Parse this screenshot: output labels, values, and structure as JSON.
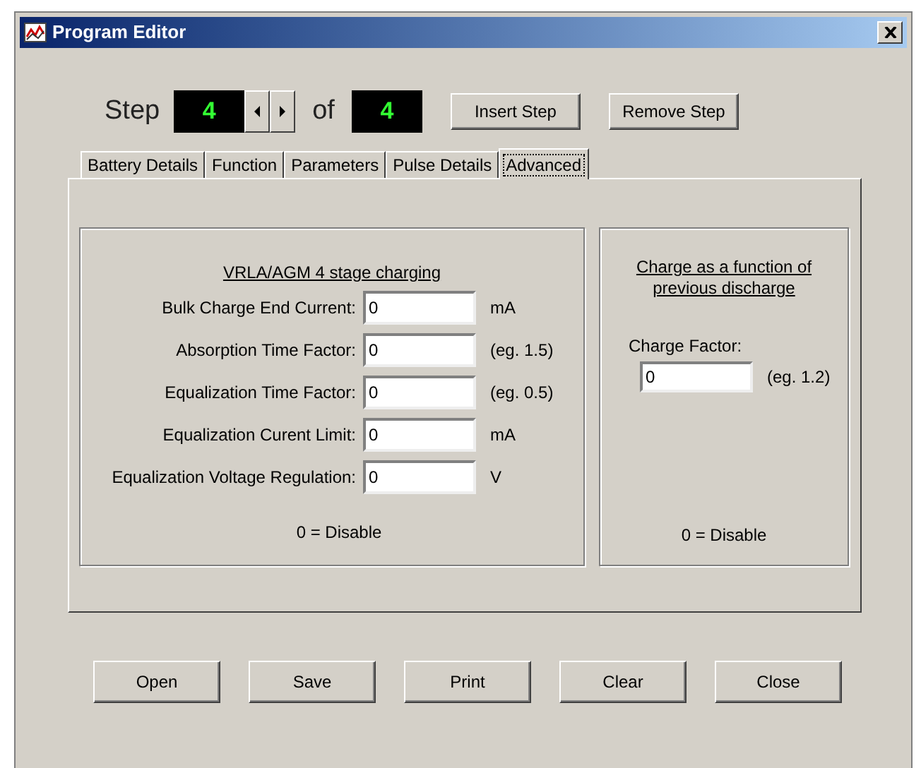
{
  "window": {
    "title": "Program Editor"
  },
  "step": {
    "label": "Step",
    "current": "4",
    "of_label": "of",
    "total": "4"
  },
  "step_buttons": [
    "Insert Step",
    "Remove Step"
  ],
  "tabs": [
    {
      "label": "Battery Details",
      "selected": false
    },
    {
      "label": "Function",
      "selected": false
    },
    {
      "label": "Parameters",
      "selected": false
    },
    {
      "label": "Pulse Details",
      "selected": false
    },
    {
      "label": "Advanced",
      "selected": true
    }
  ],
  "stage_group": {
    "title": "VRLA/AGM 4 stage charging",
    "fields": [
      {
        "label": "Bulk Charge End Current:",
        "value": "0",
        "unit": "mA"
      },
      {
        "label": "Absorption Time Factor:",
        "value": "0",
        "unit": "(eg. 1.5)"
      },
      {
        "label": "Equalization Time Factor:",
        "value": "0",
        "unit": "(eg. 0.5)"
      },
      {
        "label": "Equalization Curent Limit:",
        "value": "0",
        "unit": "mA"
      },
      {
        "label": "Equalization Voltage Regulation:",
        "value": "0",
        "unit": "V"
      }
    ],
    "note": "0 = Disable"
  },
  "discharge_group": {
    "title": "Charge as a function of previous discharge",
    "field": {
      "label": "Charge Factor:",
      "value": "0",
      "unit": "(eg. 1.2)"
    },
    "note": "0 = Disable"
  },
  "buttons": [
    "Open",
    "Save",
    "Print",
    "Clear",
    "Close"
  ]
}
